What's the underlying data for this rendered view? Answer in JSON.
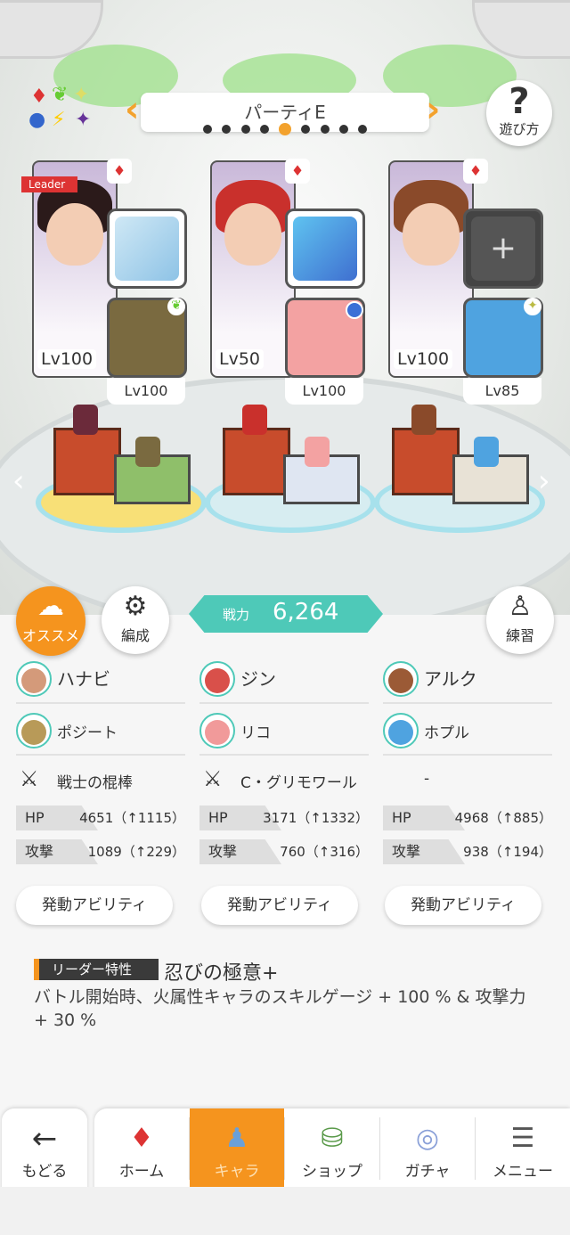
{
  "header": {
    "party_name": "パーティE",
    "page_count": 9,
    "active_page_index": 4,
    "help_label": "遊び方"
  },
  "colors": {
    "accent": "#f5941e",
    "teal": "#4ec9b8",
    "fire": "#d33333"
  },
  "slots": [
    {
      "portrait_lv": "Lv100",
      "leader_tag": "Leader",
      "element_icon": "fire-diamond-icon",
      "item_icon": "staff-icon",
      "sub_lv": "Lv100",
      "sub_element_icon": "leaf-icon"
    },
    {
      "portrait_lv": "Lv50",
      "leader_tag": "",
      "element_icon": "fire-diamond-icon",
      "item_icon": "grimoire-icon",
      "sub_lv": "Lv100",
      "sub_element_icon": "water-dot-icon"
    },
    {
      "portrait_lv": "Lv100",
      "leader_tag": "",
      "element_icon": "fire-diamond-icon",
      "item_icon": "empty-equip-icon",
      "sub_lv": "Lv85",
      "sub_element_icon": "sparkle-icon"
    }
  ],
  "buttons": {
    "osusume": "オススメ",
    "hensei": "編成",
    "renshu": "練習"
  },
  "power": {
    "label": "戦力",
    "value": "6,264"
  },
  "columns": [
    {
      "main": "ハナビ",
      "sub": "ポジート",
      "weapon": "戦士の棍棒",
      "hp_label": "HP",
      "hp": "4651（↑1115）",
      "atk_label": "攻撃",
      "atk": "1089（↑229）",
      "ability": "発動アビリティ"
    },
    {
      "main": "ジン",
      "sub": "リコ",
      "weapon": "C・グリモワール",
      "hp_label": "HP",
      "hp": "3171（↑1332）",
      "atk_label": "攻撃",
      "atk": "760（↑316）",
      "ability": "発動アビリティ"
    },
    {
      "main": "アルク",
      "sub": "ホプル",
      "weapon": "-",
      "hp_label": "HP",
      "hp": "4968（↑885）",
      "atk_label": "攻撃",
      "atk": "938（↑194）",
      "ability": "発動アビリティ"
    }
  ],
  "leader_skill": {
    "tag": "リーダー特性",
    "name": "忍びの極意+",
    "description": "バトル開始時、火属性キャラのスキルゲージ + 100 % & 攻撃力 + 30 %"
  },
  "nav": {
    "back": "もどる",
    "tabs": [
      "ホーム",
      "キャラ",
      "ショップ",
      "ガチャ",
      "メニュー"
    ],
    "active": "キャラ"
  }
}
